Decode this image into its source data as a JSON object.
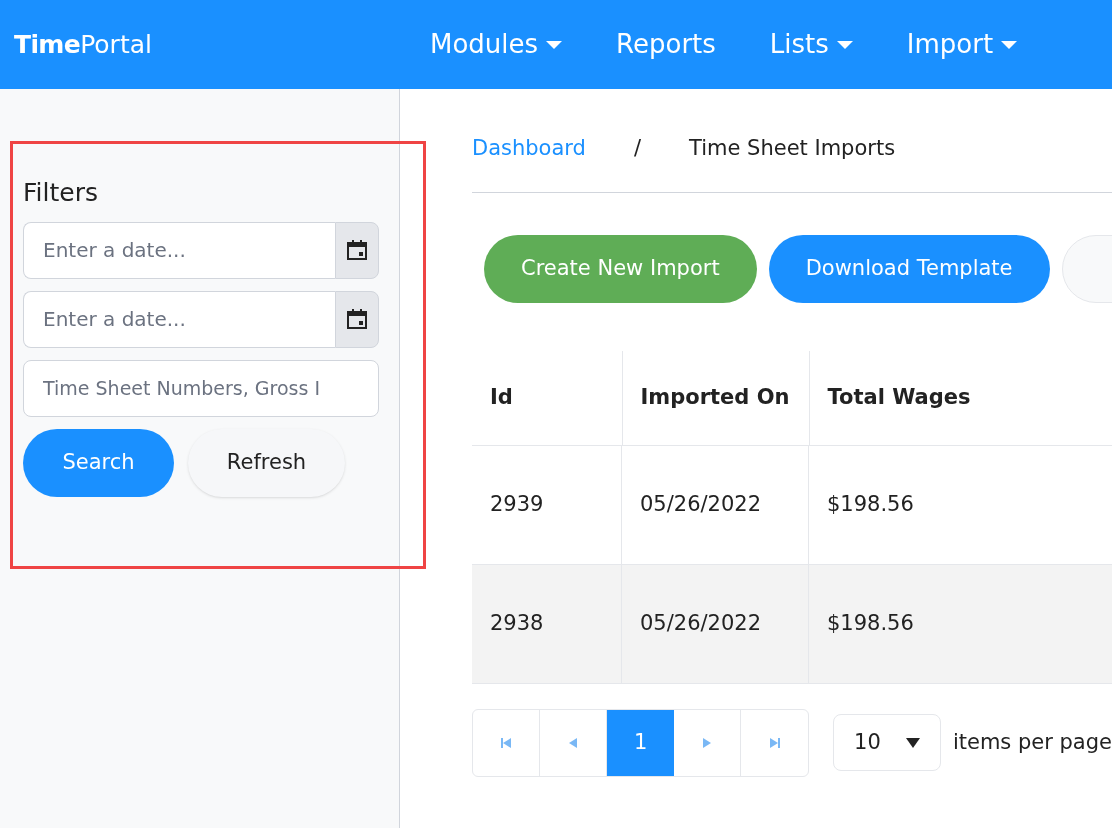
{
  "brand": {
    "bold": "Time",
    "light": "Portal"
  },
  "nav": [
    {
      "label": "Modules",
      "dropdown": true
    },
    {
      "label": "Reports",
      "dropdown": false
    },
    {
      "label": "Lists",
      "dropdown": true
    },
    {
      "label": "Import",
      "dropdown": true
    }
  ],
  "filters": {
    "title": "Filters",
    "highlighted": true,
    "date_fields": [
      {
        "placeholder": "Enter a date..."
      },
      {
        "placeholder": "Enter a date..."
      }
    ],
    "search_field": {
      "placeholder": "Time Sheet Numbers, Gross I"
    },
    "buttons": [
      {
        "label": "Search",
        "kind": "primary"
      },
      {
        "label": "Refresh",
        "kind": "secondary"
      }
    ]
  },
  "breadcrumb": [
    {
      "label": "Dashboard",
      "link": true
    },
    {
      "label": "Time Sheet Imports",
      "link": false
    }
  ],
  "breadcrumb_separator": "/",
  "actions": [
    {
      "label": "Create New Import",
      "kind": "success"
    },
    {
      "label": "Download Template",
      "kind": "primary"
    },
    {
      "kind": "light"
    }
  ],
  "table": {
    "columns": [
      "Id",
      "Imported On",
      "Total Wages"
    ],
    "rows": [
      {
        "cells": [
          "2939",
          "05/26/2022",
          "$198.56"
        ]
      },
      {
        "cells": [
          "2938",
          "05/26/2022",
          "$198.56"
        ]
      }
    ]
  },
  "pagination": {
    "pages": [
      {
        "label": "1",
        "selected": true
      }
    ],
    "page_size": "10",
    "page_size_label": "items per page"
  }
}
